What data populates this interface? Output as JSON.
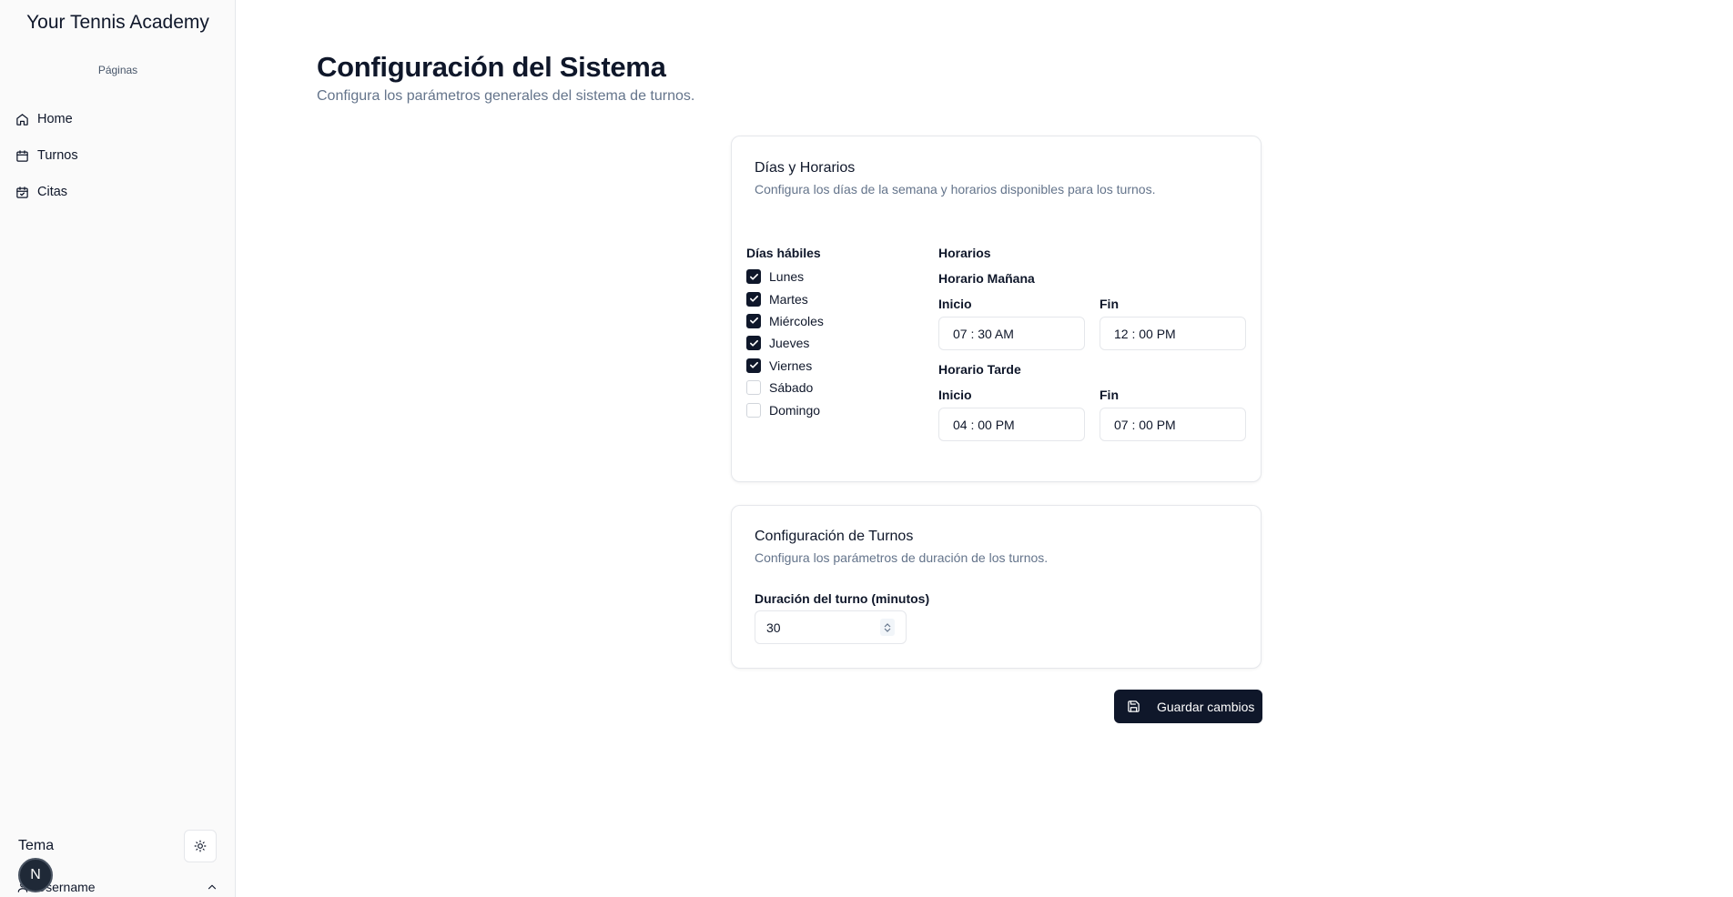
{
  "sidebar": {
    "app_title": "Your Tennis Academy",
    "group_label": "Páginas",
    "items": [
      {
        "label": "Home",
        "icon": "home-icon"
      },
      {
        "label": "Turnos",
        "icon": "calendar-icon"
      },
      {
        "label": "Citas",
        "icon": "calendar-check-icon"
      }
    ],
    "theme_label": "Tema",
    "theme_icon": "sun-icon",
    "avatar_initial": "N",
    "username": "Username"
  },
  "page": {
    "title": "Configuración del Sistema",
    "subtitle": "Configura los parámetros generales del sistema de turnos."
  },
  "schedule_card": {
    "title": "Días y Horarios",
    "description": "Configura los días de la semana y horarios disponibles para los turnos.",
    "days_label": "Días hábiles",
    "days": [
      {
        "label": "Lunes",
        "checked": true
      },
      {
        "label": "Martes",
        "checked": true
      },
      {
        "label": "Miércoles",
        "checked": true
      },
      {
        "label": "Jueves",
        "checked": true
      },
      {
        "label": "Viernes",
        "checked": true
      },
      {
        "label": "Sábado",
        "checked": false
      },
      {
        "label": "Domingo",
        "checked": false
      }
    ],
    "hours_label": "Horarios",
    "morning": {
      "label": "Horario Mañana",
      "start_label": "Inicio",
      "start_value": "07 : 30   AM",
      "end_label": "Fin",
      "end_value": "12 : 00   PM"
    },
    "afternoon": {
      "label": "Horario Tarde",
      "start_label": "Inicio",
      "start_value": "04 : 00   PM",
      "end_label": "Fin",
      "end_value": "07 : 00   PM"
    }
  },
  "turns_card": {
    "title": "Configuración de Turnos",
    "description": "Configura los parámetros de duración de los turnos.",
    "duration_label": "Duración del turno (minutos)",
    "duration_value": "30"
  },
  "actions": {
    "save_label": "Guardar cambios"
  },
  "colors": {
    "primary": "#0f172a",
    "muted_text": "#64748b",
    "border": "#e5e7eb",
    "sidebar_bg": "#fafafa"
  }
}
